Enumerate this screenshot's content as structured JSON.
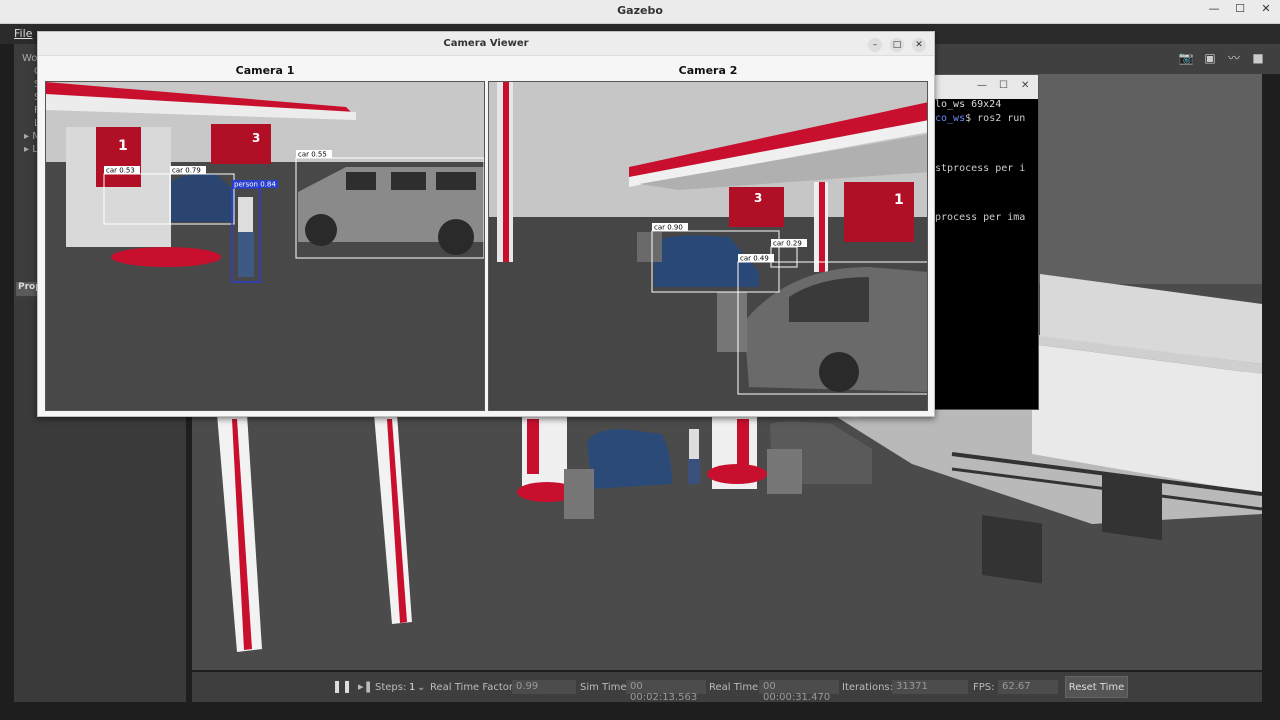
{
  "app": {
    "title": "Gazebo",
    "window_controls": [
      "—",
      "☐",
      "✕"
    ]
  },
  "menubar": {
    "file": "File"
  },
  "left_panel": {
    "tree_items": [
      "Wo",
      "G",
      "S",
      "S",
      "P",
      "L",
      "▸ M",
      "▸ L"
    ],
    "props_tab": "Prop"
  },
  "camera_viewer": {
    "title": "Camera Viewer",
    "camera1": {
      "label": "Camera 1",
      "detections": [
        {
          "label": "car 0.53",
          "color": "#ffffff"
        },
        {
          "label": "car 0.79",
          "color": "#ffffff"
        },
        {
          "label": "person 0.84",
          "color": "#2a3fd0"
        },
        {
          "label": "car 0.55",
          "color": "#ffffff"
        }
      ],
      "pump_numbers": [
        "1",
        "3"
      ]
    },
    "camera2": {
      "label": "Camera 2",
      "detections": [
        {
          "label": "car 0.90",
          "color": "#ffffff"
        },
        {
          "label": "car 0.29",
          "color": "#ffffff"
        },
        {
          "label": "car 0.49",
          "color": "#ffffff"
        }
      ],
      "pump_numbers": [
        "3",
        "1"
      ]
    }
  },
  "terminal": {
    "title_fragment": "lo_ws 69x24",
    "lines": [
      {
        "prefix": "co_ws",
        "text": "$ ros2 run"
      },
      {
        "prefix": "",
        "text": "stprocess per i"
      },
      {
        "prefix": "",
        "text": "process per ima"
      }
    ]
  },
  "statusbar": {
    "steps_label": "Steps:",
    "steps_value": "1",
    "rtf_label": "Real Time Factor:",
    "rtf_value": "0.99",
    "sim_time_label": "Sim Time:",
    "sim_time_value": "00 00:02:13.563",
    "real_time_label": "Real Time:",
    "real_time_value": "00 00:00:31.470",
    "iterations_label": "Iterations:",
    "iterations_value": "31371",
    "fps_label": "FPS:",
    "fps_value": "62.67",
    "reset_button": "Reset Time"
  },
  "colors": {
    "brand_red": "#c8102e",
    "scene_ground": "#4a4a4a",
    "detection_box": "#ffffff",
    "person_box": "#2a3fd0"
  }
}
